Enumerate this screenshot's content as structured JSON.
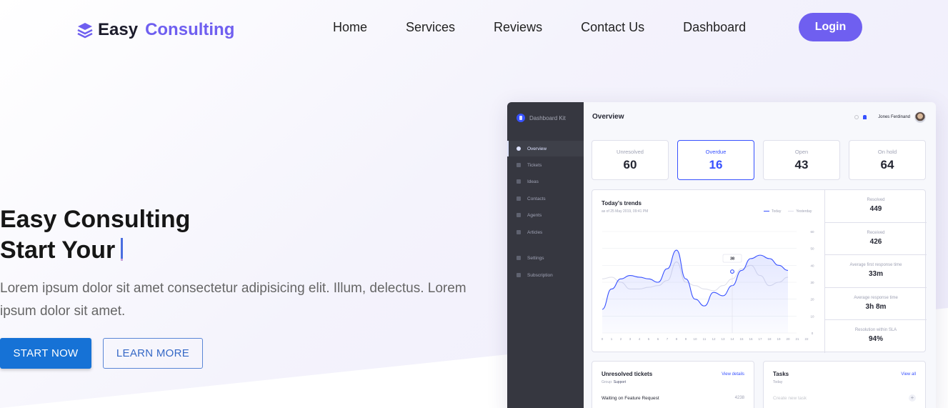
{
  "brand": {
    "word1": "Easy",
    "word2": "Consulting"
  },
  "nav": {
    "links": [
      "Home",
      "Services",
      "Reviews",
      "Contact Us",
      "Dashboard"
    ],
    "login": "Login"
  },
  "hero": {
    "title_line1": "Easy Consulting",
    "title_line2": "Start Your",
    "description": "Lorem ipsum dolor sit amet consectetur adipisicing elit. Illum, delectus. Lorem ipsum dolor sit amet.",
    "start_button": "START NOW",
    "learn_button": "LEARN MORE"
  },
  "colors": {
    "accent": "#6f5ff0",
    "primary_button": "#1672d6",
    "dashboard_blue": "#3751ff",
    "sidebar": "#363740"
  },
  "dashboard": {
    "kit_name": "Dashboard Kit",
    "page_title": "Overview",
    "user_name": "Jones Ferdinand",
    "sidebar": [
      "Overview",
      "Tickets",
      "Ideas",
      "Contacts",
      "Agents",
      "Articles",
      "Settings",
      "Subscription"
    ],
    "stats": [
      {
        "label": "Unresolved",
        "value": "60"
      },
      {
        "label": "Overdue",
        "value": "16"
      },
      {
        "label": "Open",
        "value": "43"
      },
      {
        "label": "On hold",
        "value": "64"
      }
    ],
    "trends": {
      "title": "Today's trends",
      "subtitle": "as of 25 May 2019, 09:41 PM",
      "legend_today": "Today",
      "legend_yesterday": "Yesterday",
      "tooltip": "38"
    },
    "kpis": [
      {
        "label": "Resolved",
        "value": "449"
      },
      {
        "label": "Received",
        "value": "426"
      },
      {
        "label": "Average first response time",
        "value": "33m"
      },
      {
        "label": "Average response time",
        "value": "3h 8m"
      },
      {
        "label": "Resolution within SLA",
        "value": "94%"
      }
    ],
    "unresolved": {
      "title": "Unresolved tickets",
      "link": "View details",
      "group_label": "Group:",
      "group": "Support",
      "row": "Waiting on Feature Request",
      "row_value": "4238"
    },
    "tasks": {
      "title": "Tasks",
      "link": "View all",
      "sub": "Today",
      "row": "Create new task"
    }
  },
  "chart_data": {
    "type": "line",
    "title": "Today's trends",
    "x": [
      0,
      1,
      2,
      3,
      4,
      5,
      6,
      7,
      8,
      9,
      10,
      11,
      12,
      13,
      14,
      15,
      16,
      17,
      18,
      19,
      20,
      21,
      22
    ],
    "ylim": [
      0,
      60
    ],
    "y_ticks": [
      0,
      10,
      20,
      30,
      40,
      50,
      60
    ],
    "series": [
      {
        "name": "Today",
        "color": "#3751ff",
        "values": [
          14,
          26,
          32,
          34,
          33,
          32,
          30,
          38,
          49,
          32,
          20,
          16,
          24,
          22,
          28,
          37,
          44,
          46,
          44,
          40,
          37,
          null,
          null
        ]
      },
      {
        "name": "Yesterday",
        "color": "#dfe0eb",
        "values": [
          32,
          33,
          30,
          26,
          26,
          27,
          28,
          31,
          42,
          30,
          28,
          26,
          25,
          28,
          32,
          38,
          40,
          34,
          28,
          30,
          33,
          null,
          null
        ]
      }
    ],
    "highlight": {
      "x": 14,
      "y": 38
    },
    "grid": true,
    "legend_position": "top-right"
  }
}
